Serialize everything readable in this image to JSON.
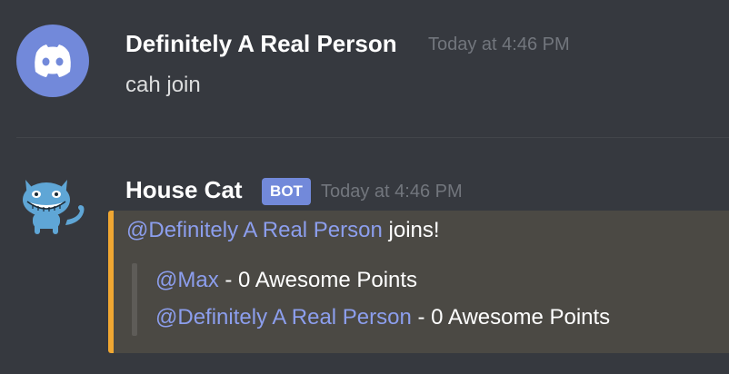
{
  "messages": [
    {
      "author": "Definitely A Real Person",
      "timestamp": "Today at 4:46 PM",
      "avatar_icon": "discord-logo-icon",
      "text": "cah join"
    },
    {
      "author": "House Cat",
      "bot_tag": "BOT",
      "timestamp": "Today at 4:46 PM",
      "avatar_icon": "grinning-cat-icon",
      "embed": {
        "accent_color": "#f0a732",
        "header_mention": "@Definitely A Real Person",
        "header_text": " joins!",
        "lines": [
          {
            "mention": "@Max",
            "text": " - 0 Awesome Points"
          },
          {
            "mention": "@Definitely A Real Person",
            "text": " - 0 Awesome Points"
          }
        ]
      }
    }
  ],
  "colors": {
    "background": "#36393f",
    "mention": "#8c9eed",
    "bot_tag": "#7289da",
    "discord_blurple": "#7289da",
    "cat_blue": "#5fa6d6"
  }
}
